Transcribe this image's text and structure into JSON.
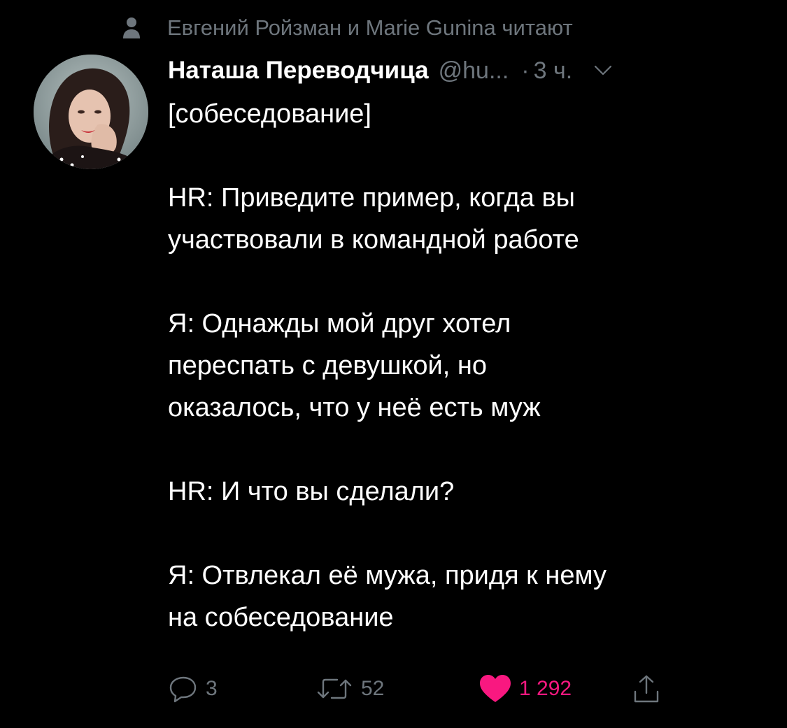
{
  "social_context": {
    "text": "Евгений Ройзман и Marie Gunina читают",
    "icon": "person-icon"
  },
  "tweet": {
    "author_name": "Наташа Переводчица",
    "author_handle": "@hu...",
    "separator": "·",
    "timestamp": "3 ч.",
    "lines": [
      "[собеседование]",
      "",
      "HR: Приведите пример, когда вы",
      "участвовали в командной работе",
      "",
      "Я: Однажды мой друг хотел",
      "переспать с девушкой, но",
      "оказалось, что у неё есть муж",
      "",
      "HR:  И что вы сделали?",
      "",
      "Я: Отвлекал её мужа, придя к нему",
      "на собеседование"
    ]
  },
  "actions": {
    "reply": {
      "count": "3",
      "icon": "reply-icon"
    },
    "retweet": {
      "count": "52",
      "icon": "retweet-icon"
    },
    "like": {
      "count": "1 292",
      "icon": "heart-icon",
      "liked": true
    },
    "share": {
      "icon": "share-icon"
    }
  },
  "colors": {
    "background": "#000000",
    "primary_text": "#ffffff",
    "secondary_text": "#6e767d",
    "like": "#f91880"
  }
}
